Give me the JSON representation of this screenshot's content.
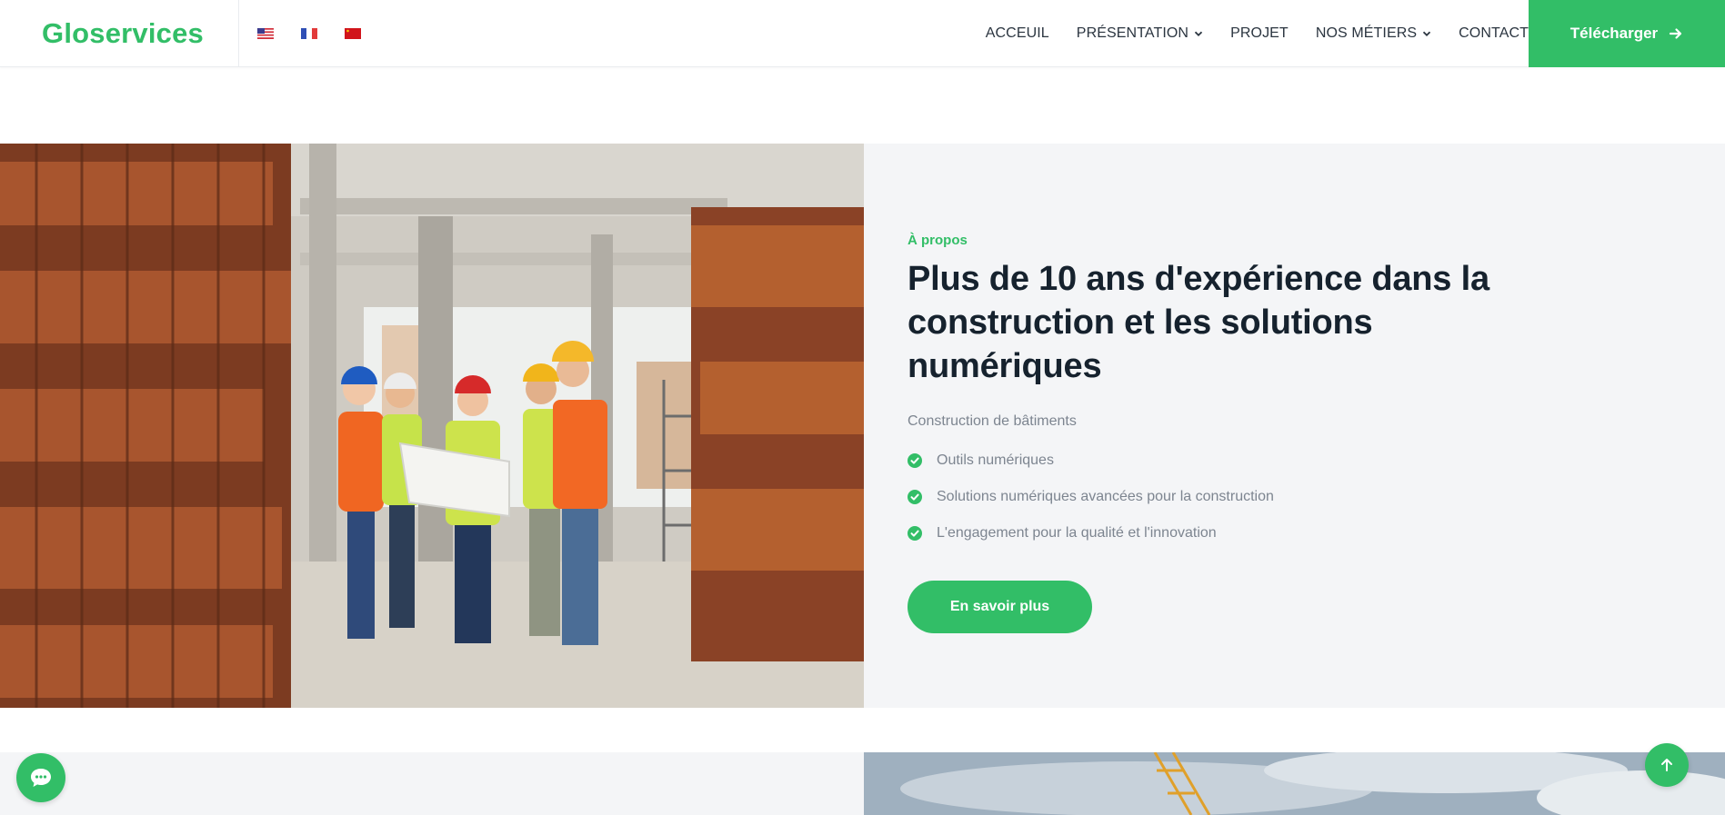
{
  "header": {
    "brand": "Gloservices",
    "languages": [
      {
        "icon": "us-flag-icon"
      },
      {
        "icon": "fr-flag-icon"
      },
      {
        "icon": "cn-flag-icon"
      }
    ],
    "nav": [
      {
        "label": "ACCEUIL",
        "dropdown": false
      },
      {
        "label": "PRÉSENTATION",
        "dropdown": true
      },
      {
        "label": "PROJET",
        "dropdown": false
      },
      {
        "label": "NOS MÉTIERS",
        "dropdown": true
      },
      {
        "label": "CONTACT",
        "dropdown": false
      }
    ],
    "download_label": "Télécharger",
    "download_icon": "arrow-right-icon"
  },
  "about": {
    "eyebrow": "À propos",
    "headline": "Plus de 10 ans d'expérience dans la construction et les solutions numériques",
    "subtitle": "Construction de bâtiments",
    "items": [
      "Outils numériques",
      "Solutions numériques avancées pour la construction",
      "L'engagement pour la qualité et l'innovation"
    ],
    "button_label": "En savoir plus",
    "image": "construction-workers-photo"
  },
  "floating": {
    "chat_icon": "chat-icon",
    "top_icon": "arrow-up-icon"
  },
  "colors": {
    "brand": "#32be67",
    "heading": "#16222e",
    "muted": "#7d8590",
    "section_bg": "#f4f5f7"
  }
}
